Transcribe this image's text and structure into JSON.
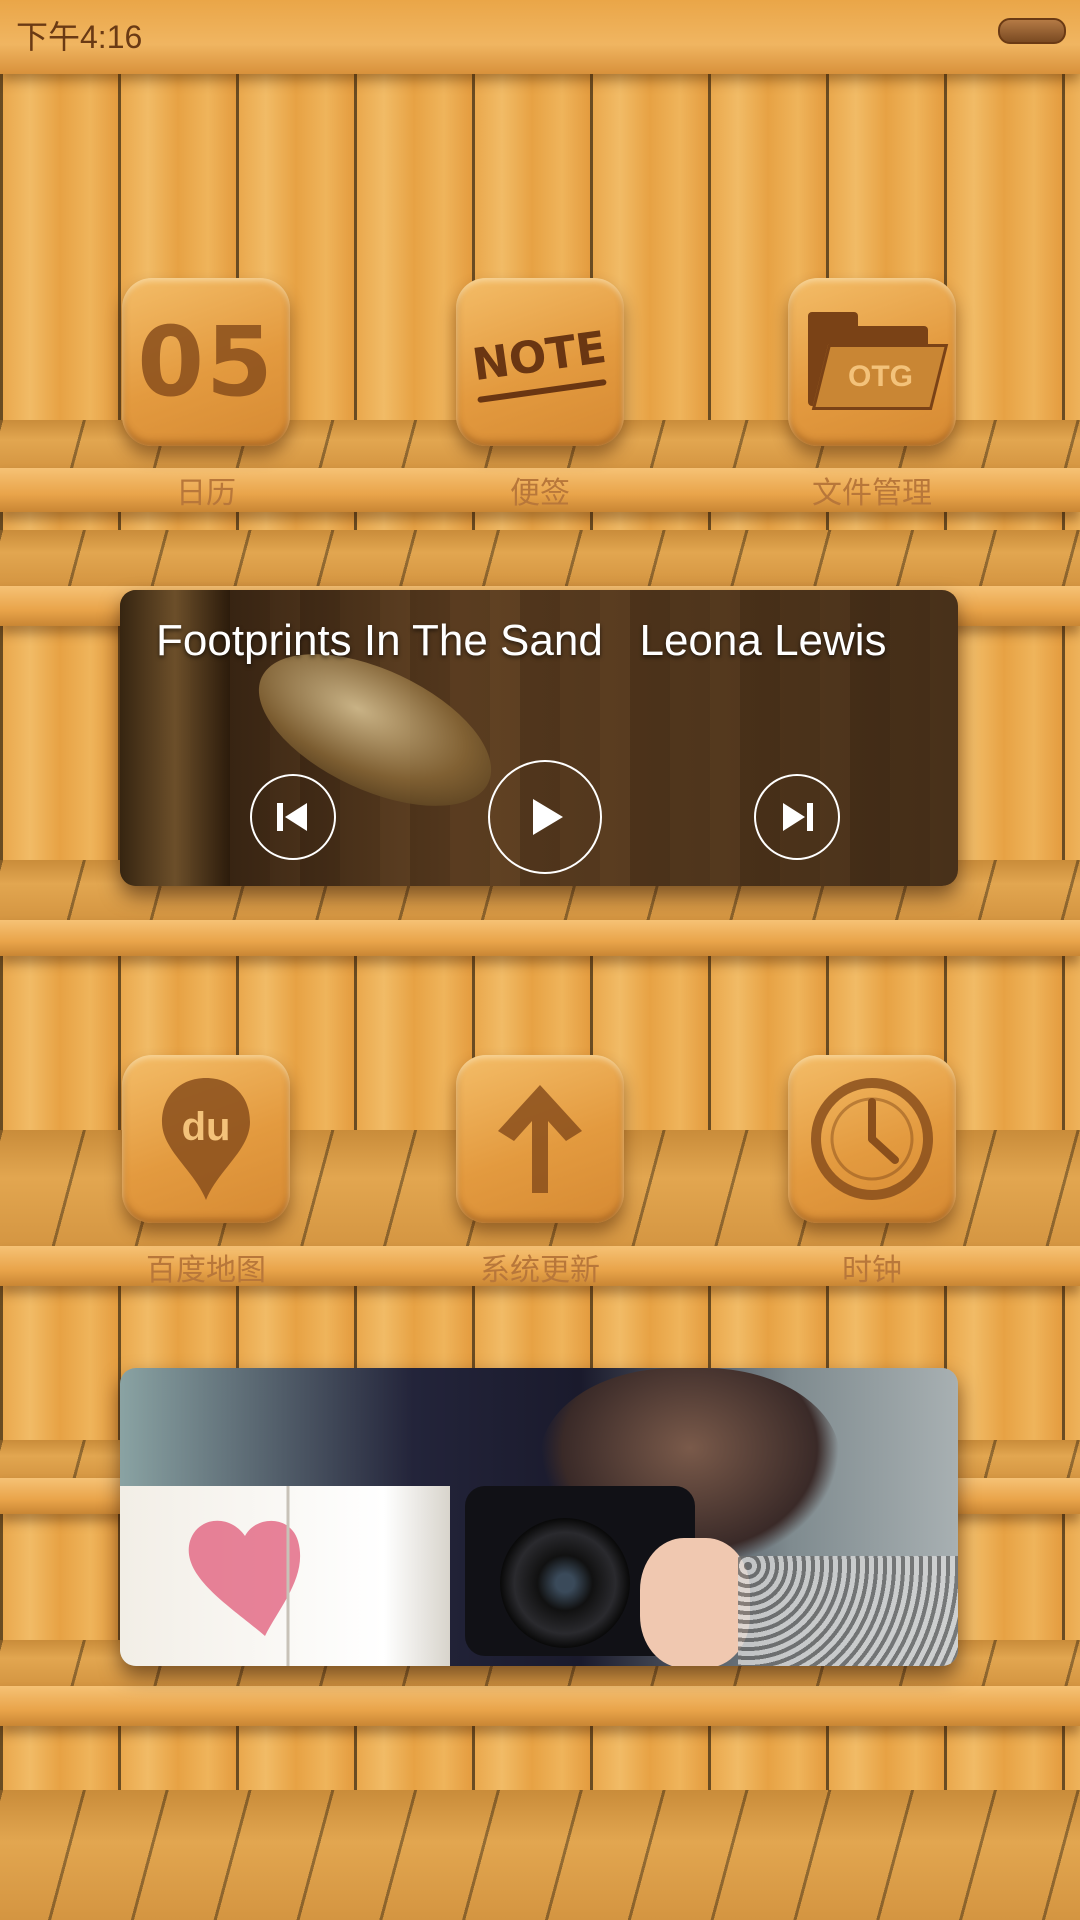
{
  "status_bar": {
    "time": "下午4:16"
  },
  "apps_row1": [
    {
      "label": "日历",
      "icon": "calendar-icon",
      "glyph": "05"
    },
    {
      "label": "便签",
      "icon": "note-icon",
      "glyph": "NOTE"
    },
    {
      "label": "文件管理",
      "icon": "folder-otg-icon",
      "glyph": "OTG"
    }
  ],
  "music_widget": {
    "song": "Footprints In The Sand",
    "artist": "Leona Lewis"
  },
  "apps_row2": [
    {
      "label": "百度地图",
      "icon": "map-pin-icon",
      "glyph": "du"
    },
    {
      "label": "系统更新",
      "icon": "arrow-up-icon"
    },
    {
      "label": "时钟",
      "icon": "clock-icon"
    }
  ],
  "colors": {
    "wood": "#e9a64a",
    "label": "#b8773a",
    "engrave": "#8a4f1c"
  }
}
